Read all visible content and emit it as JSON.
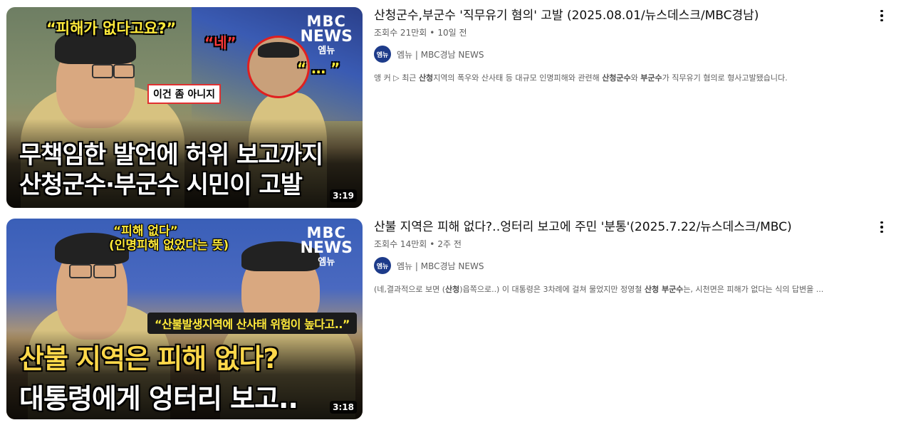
{
  "videos": [
    {
      "title": "산청군수,부군수 '직무유기 혐의' 고발 (2025.08.01/뉴스데스크/MBC경남)",
      "views": "조회수 21만회",
      "age": "10일 전",
      "channel": "엠뉴 | MBC경남 NEWS",
      "avatar_text": "엠뉴",
      "description": {
        "p1": "앵 커 ▷ 최근 ",
        "b1": "산청",
        "p2": "지역의 폭우와 산사태 등 대규모 인명피해와 관련해 ",
        "b2": "산청군수",
        "p3": "와 ",
        "b3": "부군수",
        "p4": "가 직무유기 혐의로 형사고발됐습니다."
      },
      "duration": "3:19",
      "thumbnail": {
        "quote_top": "“피해가 없다고요?”",
        "quote_ne": "“네”",
        "quote_dots": "“ … ”",
        "box_label": "이건 좀 아니지",
        "line1": "무책임한 발언에 허위 보고까지",
        "line2": "산청군수·부군수 시민이 고발",
        "logo": {
          "l1": "MBC",
          "l2": "NEWS",
          "l3": "엠뉴"
        }
      }
    },
    {
      "title": "산불 지역은 피해 없다?‥엉터리 보고에 주민 '분통'(2025.7.22/뉴스데스크/MBC)",
      "views": "조회수 14만회",
      "age": "2주 전",
      "channel": "엠뉴 | MBC경남 NEWS",
      "avatar_text": "엠뉴",
      "description": {
        "p1": "(네,결과적으로 보면 (",
        "b1": "산청",
        "p2": ")읍쪽으로..) 이 대통령은 3차례에 걸쳐 물었지만 정영철 ",
        "b2": "산청 부군수",
        "p3": "는, 시천면은 피해가 없다는 식의 답변을 ...",
        "b3": "",
        "p4": ""
      },
      "duration": "3:18",
      "thumbnail": {
        "quote_top": "“피해 없다”",
        "quote_sub": "(인명피해 없었다는 뜻)",
        "banner": "“산불발생지역에 산사태 위험이 높다고..”",
        "line1": "산불 지역은 피해 없다?",
        "line2": "대통령에게 엉터리 보고..",
        "logo": {
          "l1": "MBC",
          "l2": "NEWS",
          "l3": "엠뉴"
        }
      }
    }
  ]
}
